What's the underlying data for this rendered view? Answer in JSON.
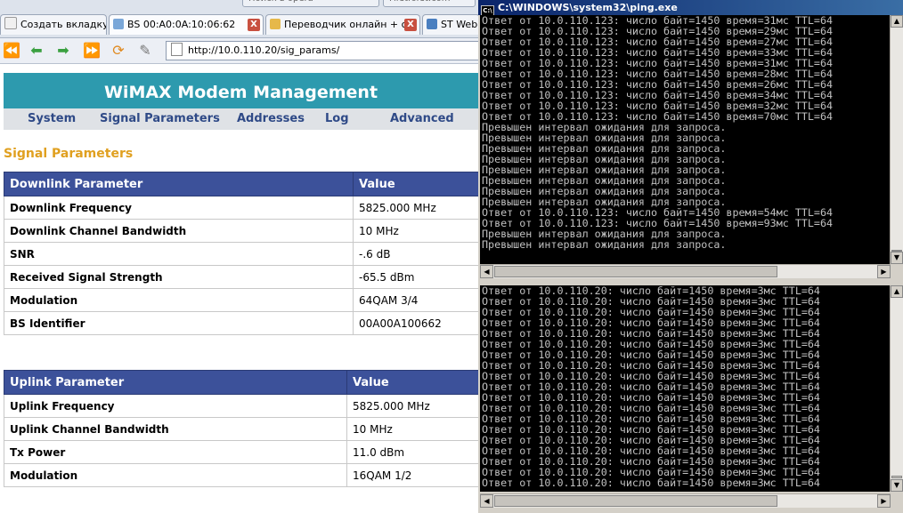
{
  "browser": {
    "ghost_tabs": [
      "Поиск в opera",
      "Firstforst.com"
    ],
    "tabs": [
      {
        "label": "Создать вкладку",
        "closable": false,
        "icon": "new-tab-icon"
      },
      {
        "label": "BS 00:A0:0A:10:06:62",
        "closable": true,
        "icon": "page-icon"
      },
      {
        "label": "Переводчик онлайн + с...",
        "closable": true,
        "icon": "page-icon"
      },
      {
        "label": "ST Web",
        "closable": false,
        "icon": "page-icon"
      }
    ],
    "close_glyph": "X",
    "url": "http://10.0.110.20/sig_params/"
  },
  "page": {
    "header_title": "WiMAX Modem Management",
    "nav": [
      "System",
      "Signal Parameters",
      "Addresses",
      "Log",
      "Advanced"
    ],
    "section_title": "Signal Parameters",
    "downlink": {
      "headers": [
        "Downlink Parameter",
        "Value"
      ],
      "rows": [
        [
          "Downlink Frequency",
          "5825.000 MHz"
        ],
        [
          "Downlink Channel Bandwidth",
          "10 MHz"
        ],
        [
          "SNR",
          "-.6 dB"
        ],
        [
          "Received Signal Strength",
          "-65.5 dBm"
        ],
        [
          "Modulation",
          "64QAM 3/4"
        ],
        [
          "BS Identifier",
          "00A00A100662"
        ]
      ]
    },
    "uplink": {
      "headers": [
        "Uplink Parameter",
        "Value"
      ],
      "rows": [
        [
          "Uplink Frequency",
          "5825.000 MHz"
        ],
        [
          "Uplink Channel Bandwidth",
          "10 MHz"
        ],
        [
          "Tx Power",
          "11.0 dBm"
        ],
        [
          "Modulation",
          "16QAM 1/2"
        ]
      ]
    },
    "colors": {
      "header_bg": "#2d9aae",
      "table_header_bg": "#3c519a",
      "section_title": "#e0a020",
      "nav_link": "#2f4a87"
    }
  },
  "console_top": {
    "title": "C:\\WINDOWS\\system32\\ping.exe",
    "lines": [
      "Ответ от 10.0.110.123: число байт=1450 время=31мс TTL=64",
      "Ответ от 10.0.110.123: число байт=1450 время=29мс TTL=64",
      "Ответ от 10.0.110.123: число байт=1450 время=27мс TTL=64",
      "Ответ от 10.0.110.123: число байт=1450 время=33мс TTL=64",
      "Ответ от 10.0.110.123: число байт=1450 время=31мс TTL=64",
      "Ответ от 10.0.110.123: число байт=1450 время=28мс TTL=64",
      "Ответ от 10.0.110.123: число байт=1450 время=26мс TTL=64",
      "Ответ от 10.0.110.123: число байт=1450 время=34мс TTL=64",
      "Ответ от 10.0.110.123: число байт=1450 время=32мс TTL=64",
      "Ответ от 10.0.110.123: число байт=1450 время=70мс TTL=64",
      "Превышен интервал ожидания для запроса.",
      "Превышен интервал ожидания для запроса.",
      "Превышен интервал ожидания для запроса.",
      "Превышен интервал ожидания для запроса.",
      "Превышен интервал ожидания для запроса.",
      "Превышен интервал ожидания для запроса.",
      "Превышен интервал ожидания для запроса.",
      "Превышен интервал ожидания для запроса.",
      "Ответ от 10.0.110.123: число байт=1450 время=54мс TTL=64",
      "Ответ от 10.0.110.123: число байт=1450 время=93мс TTL=64",
      "Превышен интервал ожидания для запроса.",
      "Превышен интервал ожидания для запроса."
    ]
  },
  "console_bottom": {
    "lines": [
      "Ответ от 10.0.110.20: число байт=1450 время=3мс TTL=64",
      "Ответ от 10.0.110.20: число байт=1450 время=3мс TTL=64",
      "Ответ от 10.0.110.20: число байт=1450 время=3мс TTL=64",
      "Ответ от 10.0.110.20: число байт=1450 время=3мс TTL=64",
      "Ответ от 10.0.110.20: число байт=1450 время=3мс TTL=64",
      "Ответ от 10.0.110.20: число байт=1450 время=3мс TTL=64",
      "Ответ от 10.0.110.20: число байт=1450 время=3мс TTL=64",
      "Ответ от 10.0.110.20: число байт=1450 время=3мс TTL=64",
      "Ответ от 10.0.110.20: число байт=1450 время=3мс TTL=64",
      "Ответ от 10.0.110.20: число байт=1450 время=3мс TTL=64",
      "Ответ от 10.0.110.20: число байт=1450 время=3мс TTL=64",
      "Ответ от 10.0.110.20: число байт=1450 время=3мс TTL=64",
      "Ответ от 10.0.110.20: число байт=1450 время=3мс TTL=64",
      "Ответ от 10.0.110.20: число байт=1450 время=3мс TTL=64",
      "Ответ от 10.0.110.20: число байт=1450 время=3мс TTL=64",
      "Ответ от 10.0.110.20: число байт=1450 время=3мс TTL=64",
      "Ответ от 10.0.110.20: число байт=1450 время=3мс TTL=64",
      "Ответ от 10.0.110.20: число байт=1450 время=3мс TTL=64",
      "Ответ от 10.0.110.20: число байт=1450 время=3мс TTL=64"
    ]
  }
}
